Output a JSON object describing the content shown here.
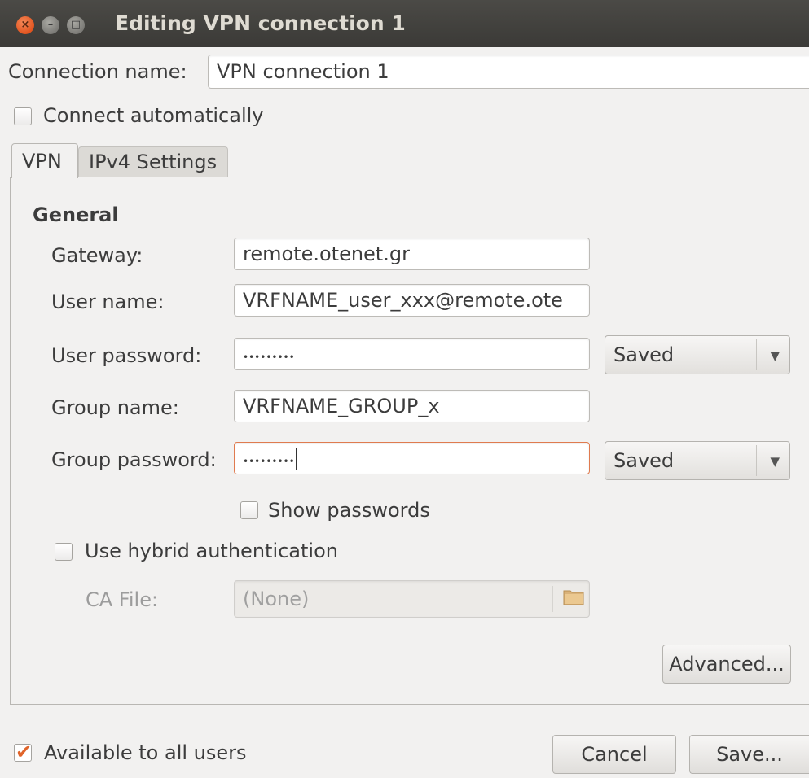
{
  "window": {
    "title": "Editing VPN connection 1"
  },
  "connection": {
    "name_label": "Connection name:",
    "name_value": "VPN connection 1",
    "auto_connect_label": "Connect automatically"
  },
  "tabs": [
    {
      "label": "VPN",
      "active": true
    },
    {
      "label": "IPv4 Settings",
      "active": false
    }
  ],
  "general": {
    "heading": "General",
    "gateway_label": "Gateway:",
    "gateway_value": "remote.otenet.gr",
    "username_label": "User name:",
    "username_value": "VRFNAME_user_xxx@remote.ote",
    "user_password_label": "User password:",
    "user_password_value": "•••••••••",
    "user_password_mode": "Saved",
    "group_name_label": "Group name:",
    "group_name_value": "VRFNAME_GROUP_x",
    "group_password_label": "Group password:",
    "group_password_value": "•••••••••",
    "group_password_mode": "Saved",
    "show_passwords_label": "Show passwords",
    "hybrid_auth_label": "Use hybrid authentication",
    "ca_file_label": "CA File:",
    "ca_file_value": "(None)",
    "advanced_label": "Advanced..."
  },
  "footer": {
    "all_users_label": "Available to all users",
    "cancel_label": "Cancel",
    "save_label": "Save..."
  },
  "icons": {
    "close": "close-icon",
    "minimize": "minimize-icon",
    "maximize": "maximize-icon",
    "dropdown": "chevron-down-icon",
    "folder": "folder-icon",
    "check": "checkmark-icon"
  },
  "colors": {
    "titlebar": "#3c3b37",
    "close_button": "#e8561f",
    "focus_border": "#e07b4f",
    "window_bg": "#f2f1f0",
    "checkmark": "#e0642a"
  }
}
